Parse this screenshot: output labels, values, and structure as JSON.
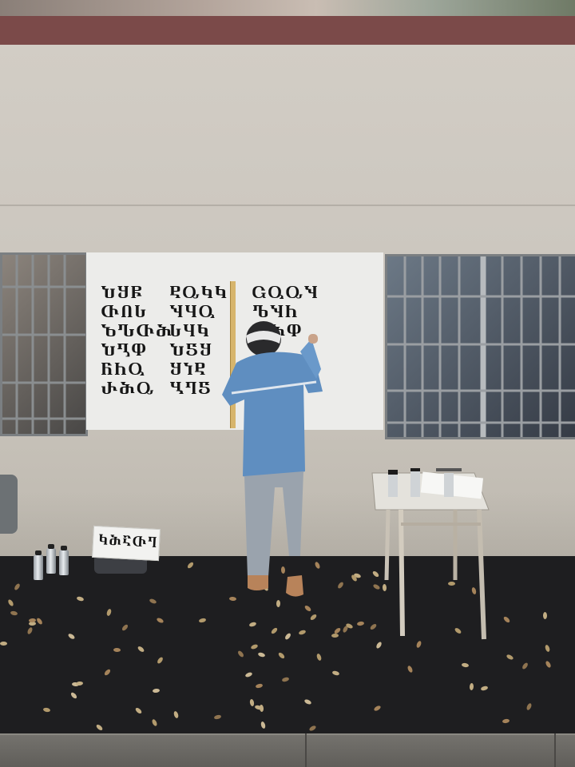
{
  "scene": {
    "mural_glyphs": {
      "column_1": [
        "ႮႸႼ",
        "ႧႶႱ",
        "ႦჀႧႫ",
        "ႮႢႴ",
        "ႬႹႳ",
        "ႰႫႭ"
      ],
      "column_2": [
        "ႲႭႩႩ",
        "ႯႷႳ",
        "ႱႷႩ",
        "ႮႽႸ",
        "ႸႨႲ",
        "ႡႤႽ"
      ],
      "column_3": [
        "ႺႳႭႯ",
        "ႪႯႹ",
        "ႦႫႴ"
      ]
    },
    "sheet_glyphs": "ႩႫႠႧႤ"
  },
  "colors": {
    "wall": "#ccc7bf",
    "roof_trim": "#7b4a49",
    "mural_panel": "#ececea",
    "jacket": "#5f8ec0",
    "ground": "#1e1e20"
  }
}
